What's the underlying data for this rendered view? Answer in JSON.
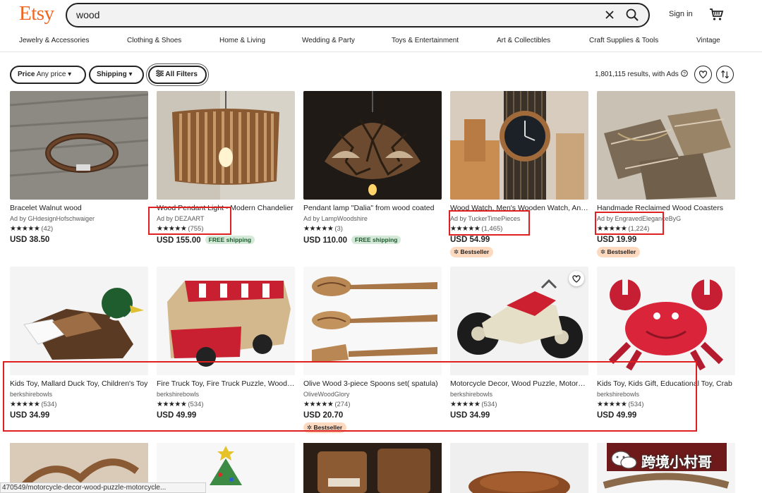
{
  "header": {
    "logo": "Etsy",
    "search_value": "wood",
    "signin": "Sign in"
  },
  "categories": [
    "Jewelry & Accessories",
    "Clothing & Shoes",
    "Home & Living",
    "Wedding & Party",
    "Toys & Entertainment",
    "Art & Collectibles",
    "Craft Supplies & Tools",
    "Vintage"
  ],
  "filters": {
    "price_label": "Price",
    "price_value": "Any price",
    "shipping": "Shipping",
    "all_filters": "All Filters",
    "results": "1,801,115 results, with Ads"
  },
  "listings": [
    {
      "title": "Bracelet Walnut wood",
      "shop": "Ad by GHdesignHofschwaiger",
      "stars": "★★★★★",
      "count": "(42)",
      "price": "USD 38.50",
      "free": "",
      "badge": ""
    },
    {
      "title": "Wood Pendant Light - Modern Chandelier",
      "shop": "Ad by DEZAART",
      "stars": "★★★★★",
      "count": "(755)",
      "price": "USD 155.00",
      "free": "FREE shipping",
      "badge": ""
    },
    {
      "title": "Pendant lamp \"Dalia\" from wood coated",
      "shop": "Ad by LampWoodshire",
      "stars": "★★★★★",
      "count": "(3)",
      "price": "USD 110.00",
      "free": "FREE shipping",
      "badge": ""
    },
    {
      "title": "Wood Watch, Men's Wooden Watch, Anniversary",
      "shop": "Ad by TuckerTimePieces",
      "stars": "★★★★★",
      "count": "(1,465)",
      "price": "USD 54.99",
      "free": "",
      "badge": "Bestseller"
    },
    {
      "title": "Handmade Reclaimed Wood Coasters",
      "shop": "Ad by EngravedEleganceByG",
      "stars": "★★★★★",
      "count": "(1,224)",
      "price": "USD 19.99",
      "free": "",
      "badge": "Bestseller"
    },
    {
      "title": "Kids Toy, Mallard Duck Toy, Children's Toy",
      "shop": "berkshirebowls",
      "stars": "★★★★★",
      "count": "(534)",
      "price": "USD 34.99",
      "free": "",
      "badge": ""
    },
    {
      "title": "Fire Truck Toy, Fire Truck Puzzle, Wooden Toy",
      "shop": "berkshirebowls",
      "stars": "★★★★★",
      "count": "(534)",
      "price": "USD 49.99",
      "free": "",
      "badge": ""
    },
    {
      "title": "Olive Wood 3-piece Spoons set( spatula)",
      "shop": "OliveWoodGlory",
      "stars": "★★★★★",
      "count": "(274)",
      "price": "USD 20.70",
      "free": "",
      "badge": "Bestseller"
    },
    {
      "title": "Motorcycle Decor, Wood Puzzle, Motorcycle Gift",
      "shop": "berkshirebowls",
      "stars": "★★★★★",
      "count": "(534)",
      "price": "USD 34.99",
      "free": "",
      "badge": ""
    },
    {
      "title": "Kids Toy, Kids Gift, Educational Toy, Crab",
      "shop": "berkshirebowls",
      "stars": "★★★★★",
      "count": "(534)",
      "price": "USD 49.99",
      "free": "",
      "badge": ""
    }
  ],
  "status_bar": "470549/motorcycle-decor-wood-puzzle-motorcycle...",
  "watermark": "跨境小村哥",
  "colors": {
    "brand": "#f1641e",
    "annotation": "#e02020",
    "free_bg": "#d4e9d7",
    "badge_bg": "#fdd9c0"
  }
}
